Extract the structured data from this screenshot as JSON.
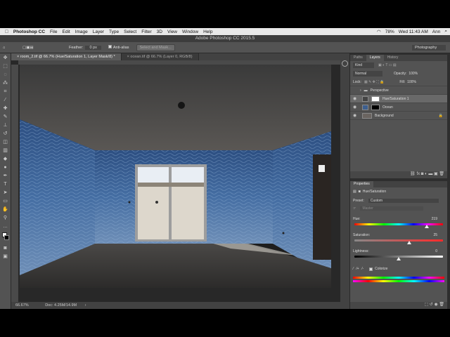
{
  "menubar": {
    "app": "Photoshop CC",
    "items": [
      "File",
      "Edit",
      "Image",
      "Layer",
      "Type",
      "Select",
      "Filter",
      "3D",
      "View",
      "Window",
      "Help"
    ],
    "battery": "78%",
    "clock": "Wed 11:43 AM",
    "user": "Ann"
  },
  "titlebar": {
    "title": "Adobe Photoshop CC 2015.5"
  },
  "options": {
    "feather_label": "Feather:",
    "feather_value": "0 px",
    "antialias": "Anti-alias",
    "select_mask": "Select and Mask...",
    "workspace": "Photography"
  },
  "tabs": [
    {
      "label": "room_2.tif @ 66.7% (Hue/Saturation 1, Layer Mask/8) *"
    },
    {
      "label": "ocean.tif @ 66.7% (Layer 0, RGB/8)"
    }
  ],
  "status": {
    "zoom": "66.67%",
    "doc": "Doc: 4.25M/14.9M"
  },
  "layers_panel": {
    "tabs": [
      "Paths",
      "Layers",
      "History"
    ],
    "kind": "Kind",
    "blend": "Normal",
    "opacity_label": "Opacity:",
    "opacity": "100%",
    "lock_label": "Lock:",
    "fill_label": "Fill:",
    "fill": "100%",
    "layers": [
      {
        "name": "Perspective"
      },
      {
        "name": "Hue/Saturation 1"
      },
      {
        "name": "Ocean"
      },
      {
        "name": "Background"
      }
    ]
  },
  "properties": {
    "title": "Properties",
    "subtitle": "Hue/Saturation",
    "preset_label": "Preset:",
    "preset": "Custom",
    "channel": "Master",
    "hue_label": "Hue:",
    "hue": "219",
    "hue_level": 0.82,
    "sat_label": "Saturation:",
    "sat": "25",
    "sat_level": 0.62,
    "light_label": "Lightness:",
    "light": "0",
    "light_level": 0.5,
    "colorize": "Colorize"
  }
}
